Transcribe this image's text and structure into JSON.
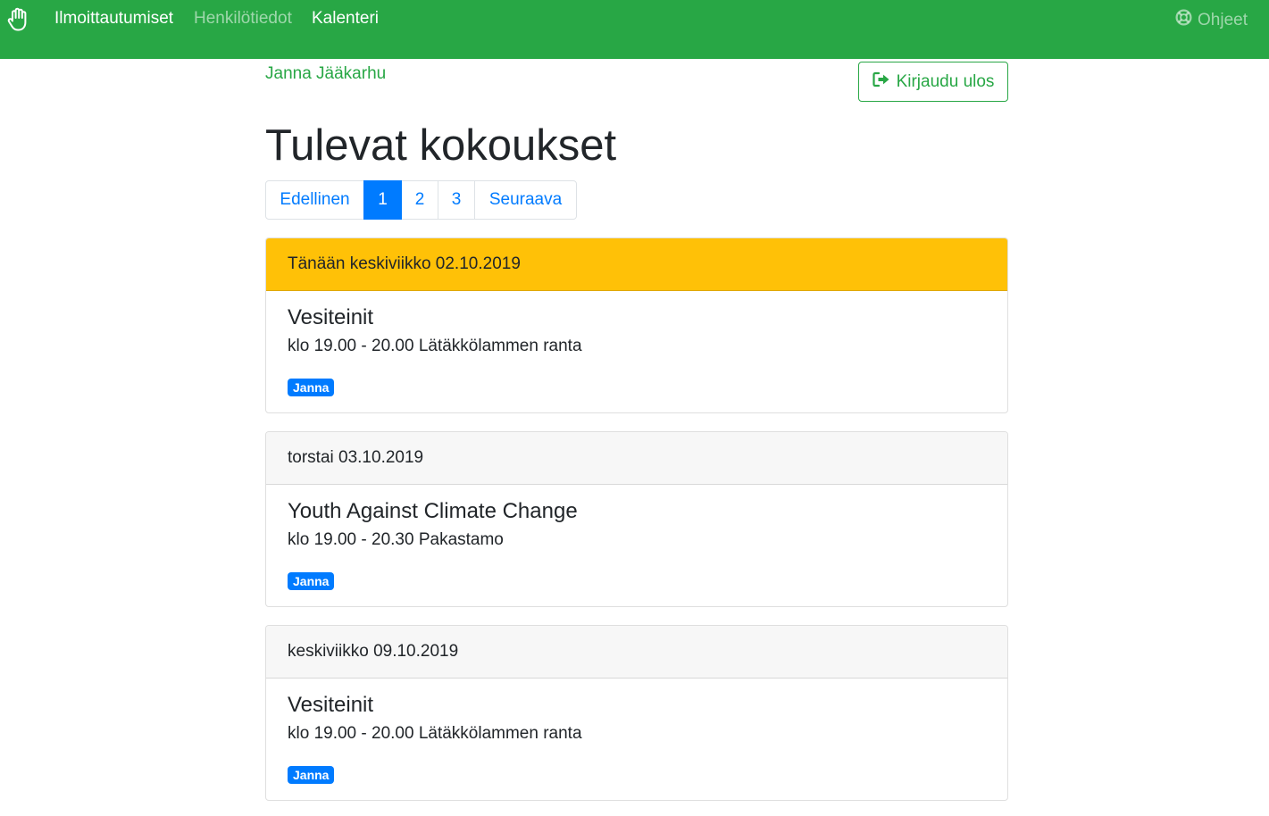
{
  "nav": {
    "brand_icon": "hand-icon",
    "links": [
      {
        "label": "Ilmoittautumiset",
        "state": "active"
      },
      {
        "label": "Henkilötiedot",
        "state": "muted"
      },
      {
        "label": "Kalenteri",
        "state": "active"
      }
    ],
    "help": {
      "label": "Ohjeet",
      "icon": "lifebuoy-icon"
    }
  },
  "user": {
    "name": "Janna Jääkarhu",
    "logout_label": "Kirjaudu ulos",
    "logout_icon": "sign-out-icon"
  },
  "page": {
    "title": "Tulevat kokoukset"
  },
  "pagination": {
    "prev": "Edellinen",
    "pages": [
      "1",
      "2",
      "3"
    ],
    "current": "1",
    "next": "Seuraava"
  },
  "meetings": [
    {
      "date_label": "Tänään keskiviikko 02.10.2019",
      "is_today": true,
      "title": "Vesiteinit",
      "details": "klo 19.00 - 20.00 Lätäkkölammen ranta",
      "participant": "Janna"
    },
    {
      "date_label": "torstai 03.10.2019",
      "is_today": false,
      "title": "Youth Against Climate Change",
      "details": "klo 19.00 - 20.30 Pakastamo",
      "participant": "Janna"
    },
    {
      "date_label": "keskiviikko 09.10.2019",
      "is_today": false,
      "title": "Vesiteinit",
      "details": "klo 19.00 - 20.00 Lätäkkölammen ranta",
      "participant": "Janna"
    }
  ],
  "colors": {
    "navbar": "#28a745",
    "today_header": "#ffc107",
    "primary": "#007bff",
    "success": "#28a745"
  }
}
